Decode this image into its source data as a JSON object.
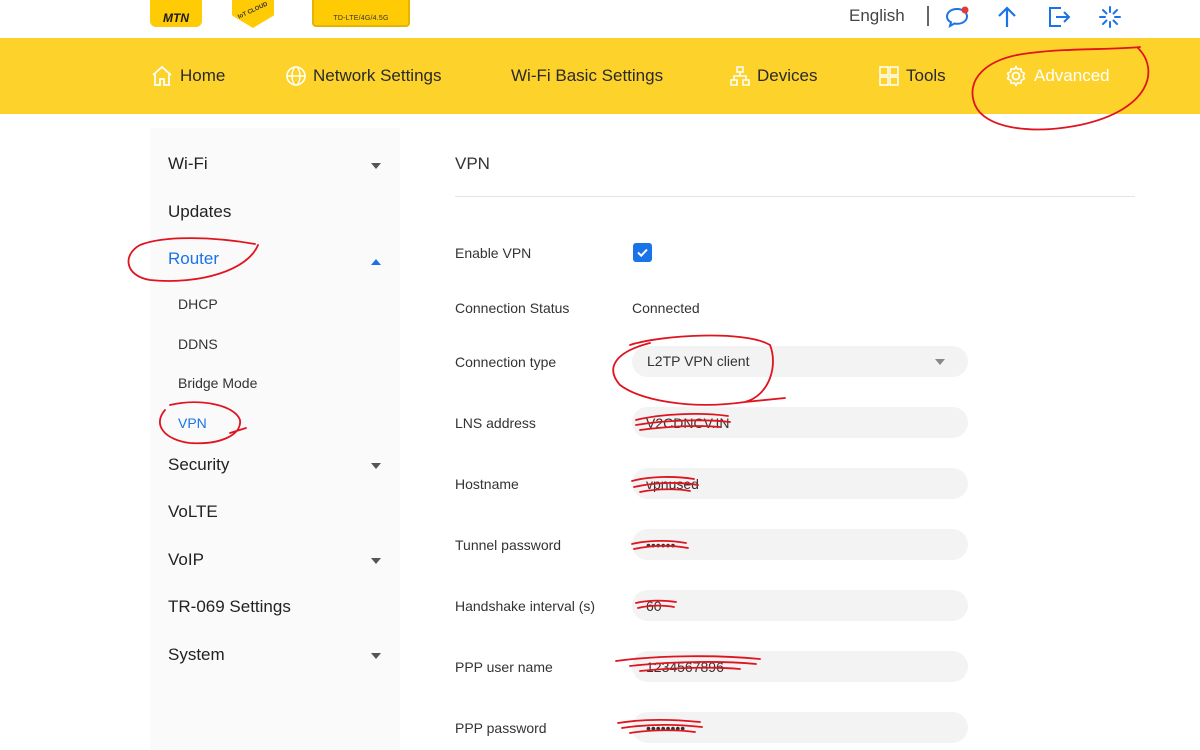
{
  "header": {
    "logos": {
      "mtn": "MTN",
      "iot": "IoT CLOUD",
      "badge": "TD-LTE/4G/4.5G"
    },
    "language": "English",
    "icons": [
      "message-icon",
      "upload-icon",
      "logout-icon",
      "loading-icon"
    ]
  },
  "nav": {
    "items": [
      {
        "label": "Home",
        "icon": "home-icon"
      },
      {
        "label": "Network Settings",
        "icon": "globe-icon"
      },
      {
        "label": "Wi-Fi Basic Settings",
        "icon": ""
      },
      {
        "label": "Devices",
        "icon": "devices-icon"
      },
      {
        "label": "Tools",
        "icon": "tools-icon"
      },
      {
        "label": "Advanced",
        "icon": "gear-icon",
        "active": true
      }
    ]
  },
  "sidebar": {
    "items": [
      {
        "label": "Wi-Fi",
        "expandable": true
      },
      {
        "label": "Updates"
      },
      {
        "label": "Router",
        "expanded": true,
        "active": true
      },
      {
        "label": "Security",
        "expandable": true
      },
      {
        "label": "VoLTE"
      },
      {
        "label": "VoIP",
        "expandable": true
      },
      {
        "label": "TR-069 Settings"
      },
      {
        "label": "System",
        "expandable": true
      }
    ],
    "router_sub": [
      "DHCP",
      "DDNS",
      "Bridge Mode",
      "VPN"
    ]
  },
  "main": {
    "title": "VPN",
    "fields": {
      "enable_vpn": {
        "label": "Enable VPN",
        "checked": true
      },
      "connection_status": {
        "label": "Connection Status",
        "value": "Connected"
      },
      "connection_type": {
        "label": "Connection type",
        "value": "L2TP VPN client"
      },
      "lns_address": {
        "label": "LNS address",
        "value": "V2CDNCV.IN"
      },
      "hostname": {
        "label": "Hostname",
        "value": "vpnused"
      },
      "tunnel_password": {
        "label": "Tunnel password",
        "value": "••••••"
      },
      "handshake_interval": {
        "label": "Handshake interval (s)",
        "value": "60"
      },
      "ppp_user_name": {
        "label": "PPP user name",
        "value": "1234567896"
      },
      "ppp_password": {
        "label": "PPP password",
        "value": "••••••••"
      }
    }
  },
  "colors": {
    "nav_bg": "#fdd22b",
    "accent_blue": "#1a73e8",
    "annotation_red": "#e0141e"
  }
}
